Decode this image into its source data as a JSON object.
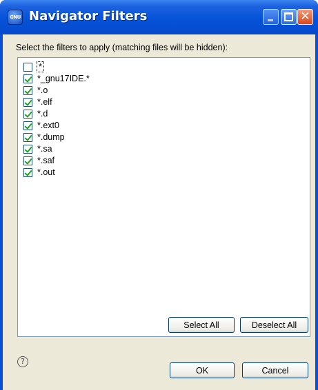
{
  "window": {
    "title": "Navigator Filters",
    "app_icon_text": "GNU"
  },
  "dialog": {
    "instruction": "Select the filters to apply (matching files will be hidden):",
    "filters": [
      {
        "label": "*",
        "checked": false
      },
      {
        "label": "*_gnu17IDE.*",
        "checked": true
      },
      {
        "label": "*.o",
        "checked": true
      },
      {
        "label": "*.elf",
        "checked": true
      },
      {
        "label": "*.d",
        "checked": true
      },
      {
        "label": "*.ext0",
        "checked": true
      },
      {
        "label": "*.dump",
        "checked": true
      },
      {
        "label": "*.sa",
        "checked": true
      },
      {
        "label": "*.saf",
        "checked": true
      },
      {
        "label": "*.out",
        "checked": true
      }
    ],
    "select_all_label": "Select All",
    "deselect_all_label": "Deselect All",
    "ok_label": "OK",
    "cancel_label": "Cancel",
    "help_icon": "?"
  }
}
